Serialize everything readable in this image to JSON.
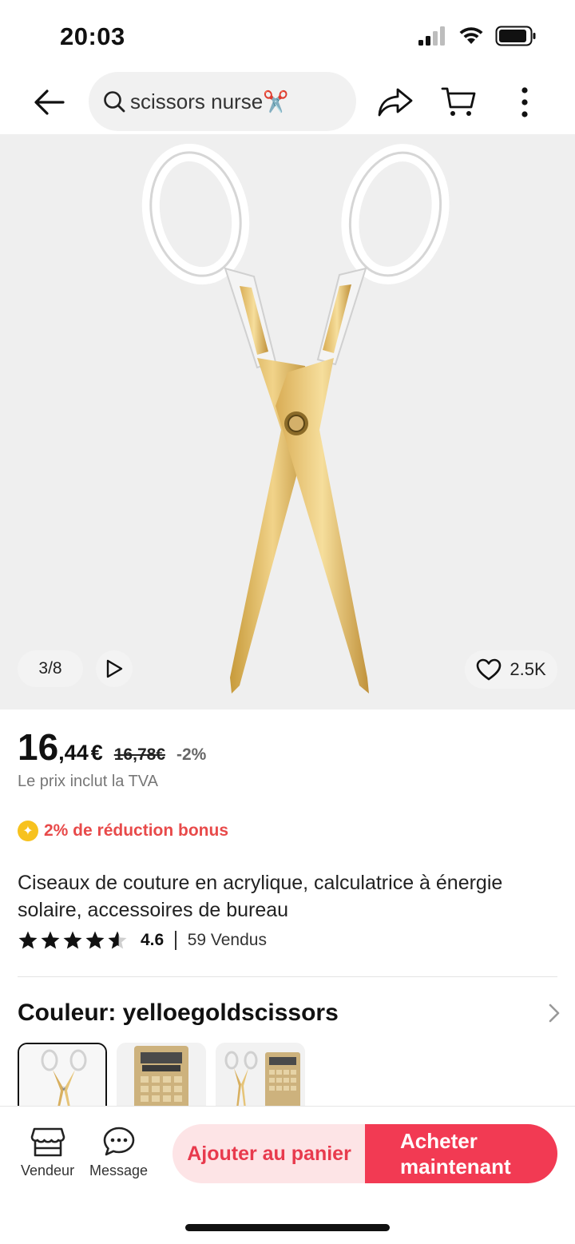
{
  "status": {
    "time": "20:03"
  },
  "header": {
    "search_text": "scissors nurse✂️"
  },
  "gallery": {
    "counter": "3/8",
    "likes": "2.5K"
  },
  "price": {
    "integer": "16",
    "decimal": ",44",
    "currency": "€",
    "old": "16,78€",
    "discount": "-2%",
    "vat_note": "Le prix inclut la TVA"
  },
  "bonus": {
    "text": "2% de réduction bonus"
  },
  "product": {
    "title": "Ciseaux de couture en acrylique, calculatrice à énergie solaire, accessoires de bureau",
    "rating": "4.6",
    "rating_stars": 4.6,
    "sold": "59 Vendus"
  },
  "variant": {
    "label": "Couleur: yelloegoldscissors"
  },
  "bottom": {
    "vendor": "Vendeur",
    "message": "Message",
    "add_to_cart": "Ajouter au panier",
    "buy_now": "Acheter maintenant"
  },
  "colors": {
    "accent": "#f23a53",
    "accent_light": "#fde4e6",
    "bonus": "#e84a4a",
    "coin": "#f7c21e"
  }
}
